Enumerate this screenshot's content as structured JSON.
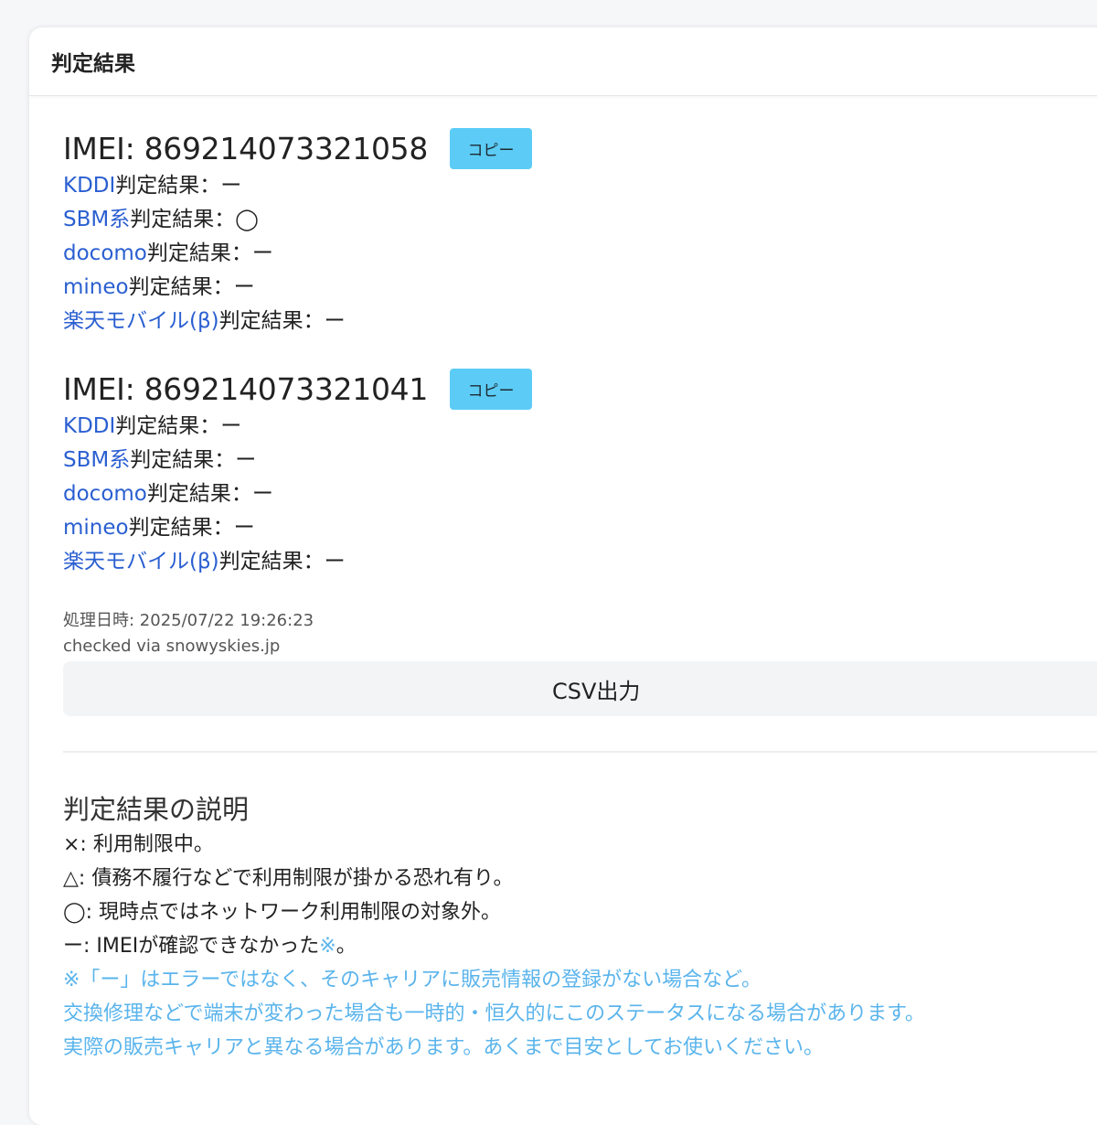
{
  "header": {
    "title": "判定結果"
  },
  "results": [
    {
      "imei_label": "IMEI: 869214073321058",
      "copy_label": "コピー",
      "lines": [
        {
          "carrier": "KDDI",
          "suffix": "判定結果：ー"
        },
        {
          "carrier": "SBM系",
          "suffix": "判定結果：◯"
        },
        {
          "carrier": "docomo",
          "suffix": "判定結果：ー"
        },
        {
          "carrier": "mineo",
          "suffix": "判定結果：ー"
        },
        {
          "carrier": "楽天モバイル(β)",
          "suffix": "判定結果：ー"
        }
      ]
    },
    {
      "imei_label": "IMEI: 869214073321041",
      "copy_label": "コピー",
      "lines": [
        {
          "carrier": "KDDI",
          "suffix": "判定結果：ー"
        },
        {
          "carrier": "SBM系",
          "suffix": "判定結果：ー"
        },
        {
          "carrier": "docomo",
          "suffix": "判定結果：ー"
        },
        {
          "carrier": "mineo",
          "suffix": "判定結果：ー"
        },
        {
          "carrier": "楽天モバイル(β)",
          "suffix": "判定結果：ー"
        }
      ]
    }
  ],
  "meta": {
    "processed": "処理日時: 2025/07/22 19:26:23",
    "checked_via": "checked via snowyskies.jp"
  },
  "csv_label": "CSV出力",
  "explanation": {
    "title": "判定結果の説明",
    "lines": [
      "×: 利用制限中。",
      "△: 債務不履行などで利用制限が掛かる恐れ有り。",
      "◯: 現時点ではネットワーク利用制限の対象外。"
    ],
    "unknown_prefix": "ー: IMEIが確認できなかった",
    "unknown_mark": "※",
    "unknown_suffix": "。",
    "notes": [
      "※「ー」はエラーではなく、そのキャリアに販売情報の登録がない場合など。",
      "交換修理などで端末が変わった場合も一時的・恒久的にこのステータスになる場合があります。",
      "実際の販売キャリアと異なる場合があります。あくまで目安としてお使いください。"
    ]
  },
  "colors": {
    "link": "#2a5fd1",
    "copy_button": "#5cccf6",
    "note": "#5ab4ec"
  }
}
